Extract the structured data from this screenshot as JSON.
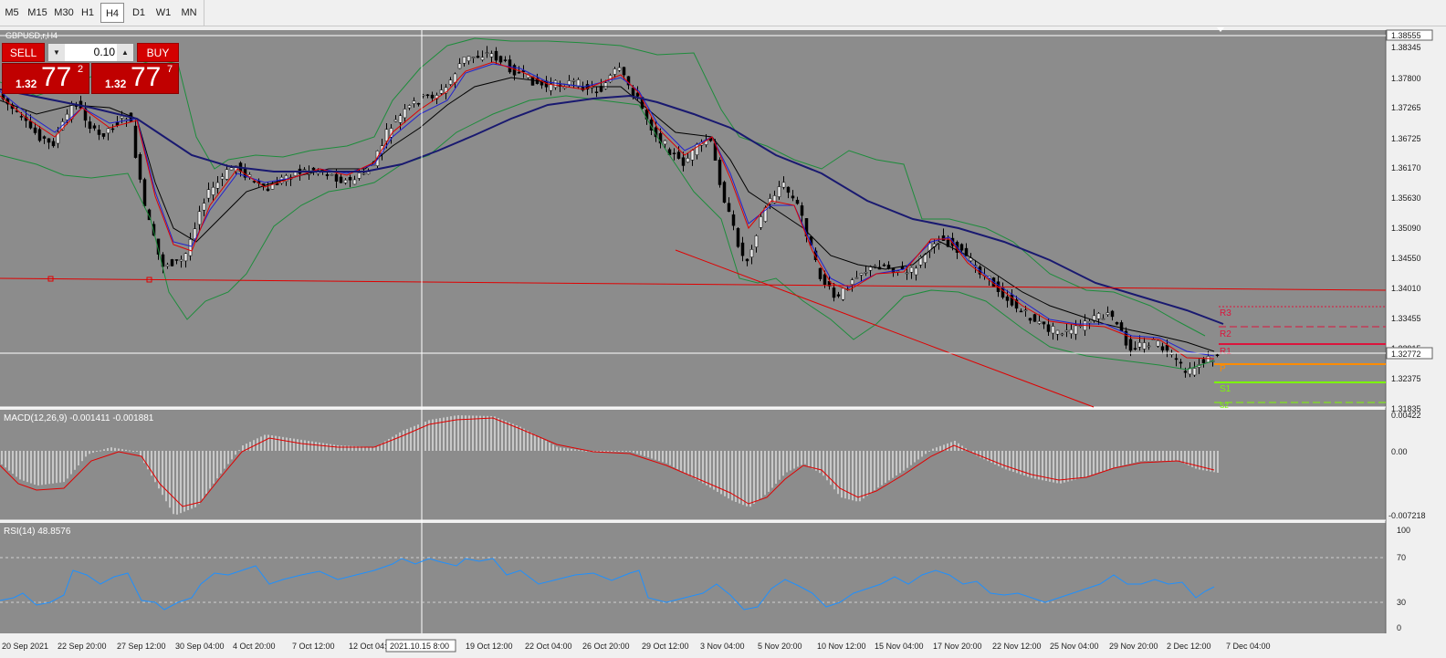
{
  "toolbar": {
    "timeframes": [
      "M5",
      "M15",
      "M30",
      "H1",
      "H4",
      "D1",
      "W1",
      "MN"
    ],
    "active": "H4"
  },
  "chart": {
    "symbol_label": "GBPUSD,r,H4",
    "background": "#8c8c8c",
    "price_axis": [
      "1.38555",
      "1.38345",
      "1.37800",
      "1.37265",
      "1.36725",
      "1.36170",
      "1.35630",
      "1.35090",
      "1.34550",
      "1.34010",
      "1.33455",
      "1.32915",
      "1.32375",
      "1.31835"
    ],
    "current_price": "1.32772",
    "pivot_labels": [
      "R3",
      "R2",
      "R1",
      "P",
      "S1",
      "S2"
    ],
    "date_axis": [
      "20 Sep 2021",
      "22 Sep 20:00",
      "27 Sep 12:00",
      "30 Sep 04:00",
      "4 Oct 20:00",
      "7 Oct 12:00",
      "12 Oct 04:00",
      "19 Oct 12:00",
      "22 Oct 04:00",
      "26 Oct 20:00",
      "29 Oct 12:00",
      "3 Nov 04:00",
      "5 Nov 20:00",
      "10 Nov 12:00",
      "15 Nov 04:00",
      "17 Nov 20:00",
      "22 Nov 12:00",
      "25 Nov 04:00",
      "29 Nov 20:00",
      "2 Dec 12:00",
      "7 Dec 04:00"
    ],
    "crosshair_date": "2021.10.15 8:00"
  },
  "trade_panel": {
    "sell_label": "SELL",
    "buy_label": "BUY",
    "volume": "0.10",
    "sell_prefix": "1.32",
    "sell_big": "77",
    "sell_sup": "2",
    "buy_prefix": "1.32",
    "buy_big": "77",
    "buy_sup": "7"
  },
  "macd": {
    "label": "MACD(12,26,9) -0.001411 -0.001881",
    "axis": [
      "0.00422",
      "0.00",
      "-0.007218"
    ]
  },
  "rsi": {
    "label": "RSI(14) 48.8576",
    "axis": [
      "100",
      "70",
      "30",
      "0"
    ]
  },
  "colors": {
    "bg": "#8c8c8c",
    "ma_slow": "#191970",
    "ma_red": "#e00000",
    "ma_blue": "#2020d0",
    "ma_black": "#000000",
    "bands": "#1e8c3c",
    "rsi_line": "#1e90ff",
    "macd_signal": "#e00000",
    "hline": "#e00000",
    "r_levels": "#dc143c",
    "p_level": "#ff8c00",
    "s_levels": "#7cfc00"
  },
  "icons": [
    "dropdown-arrow-icon",
    "up-arrow-icon",
    "fractal-up-icon",
    "fractal-down-icon"
  ]
}
